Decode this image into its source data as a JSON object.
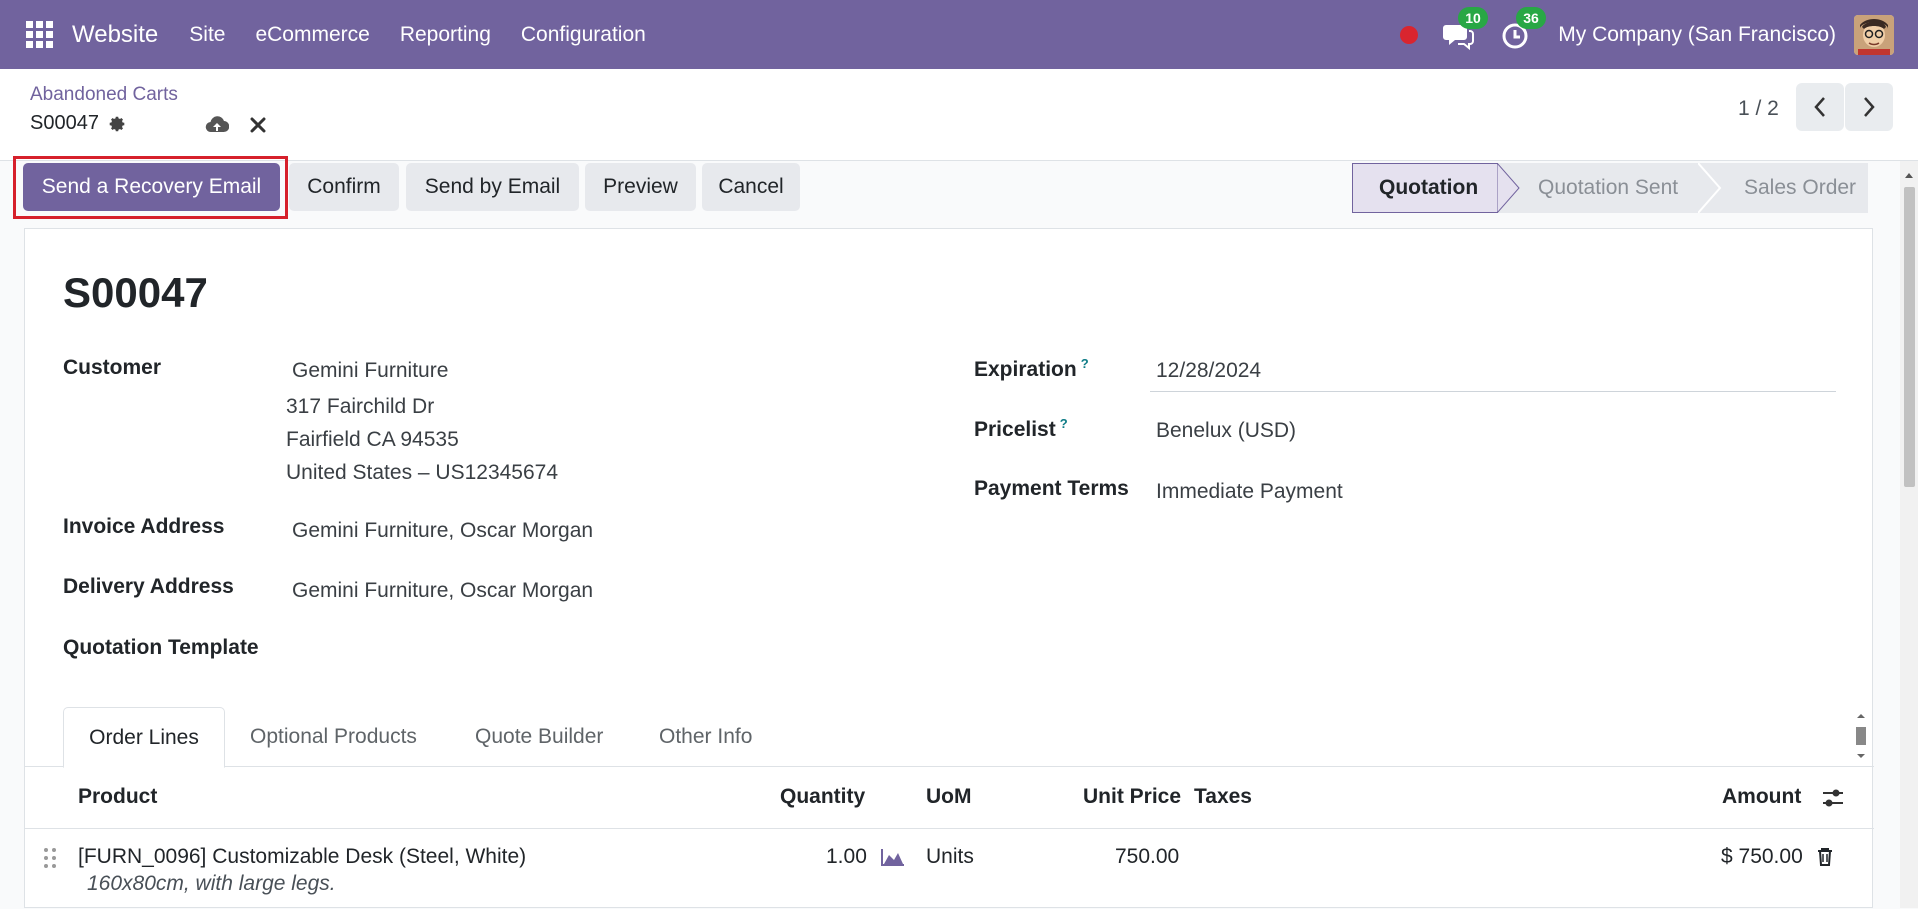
{
  "navbar": {
    "brand": "Website",
    "menu": [
      "Site",
      "eCommerce",
      "Reporting",
      "Configuration"
    ],
    "messages_count": "10",
    "activities_count": "36",
    "company": "My Company (San Francisco)"
  },
  "control": {
    "breadcrumb_parent": "Abandoned Carts",
    "record": "S00047",
    "pager": "1 / 2"
  },
  "buttons": {
    "recovery": "Send a Recovery Email",
    "confirm": "Confirm",
    "send_email": "Send by Email",
    "preview": "Preview",
    "cancel": "Cancel"
  },
  "stages": [
    "Quotation",
    "Quotation Sent",
    "Sales Order"
  ],
  "form": {
    "title": "S00047",
    "customer_label": "Customer",
    "customer_name": "Gemini Furniture",
    "customer_street": "317 Fairchild Dr",
    "customer_city": "Fairfield CA 94535",
    "customer_country": "United States – US12345674",
    "invoice_label": "Invoice Address",
    "invoice_value": "Gemini Furniture, Oscar Morgan",
    "delivery_label": "Delivery Address",
    "delivery_value": "Gemini Furniture, Oscar Morgan",
    "template_label": "Quotation Template",
    "expiration_label": "Expiration",
    "expiration_value": "12/28/2024",
    "pricelist_label": "Pricelist",
    "pricelist_value": "Benelux (USD)",
    "payment_label": "Payment Terms",
    "payment_value": "Immediate Payment",
    "help_mark": "?"
  },
  "tabs": [
    "Order Lines",
    "Optional Products",
    "Quote Builder",
    "Other Info"
  ],
  "table": {
    "headers": {
      "product": "Product",
      "quantity": "Quantity",
      "uom": "UoM",
      "unit_price": "Unit Price",
      "taxes": "Taxes",
      "amount": "Amount"
    },
    "rows": [
      {
        "product": "[FURN_0096] Customizable Desk (Steel, White)",
        "description": "160x80cm, with large legs.",
        "quantity": "1.00",
        "uom": "Units",
        "unit_price": "750.00",
        "amount": "$ 750.00"
      }
    ]
  },
  "colors": {
    "brand": "#71639e",
    "highlight": "#d6202b",
    "badge": "#28a745",
    "record_dot": "#d9252f"
  }
}
